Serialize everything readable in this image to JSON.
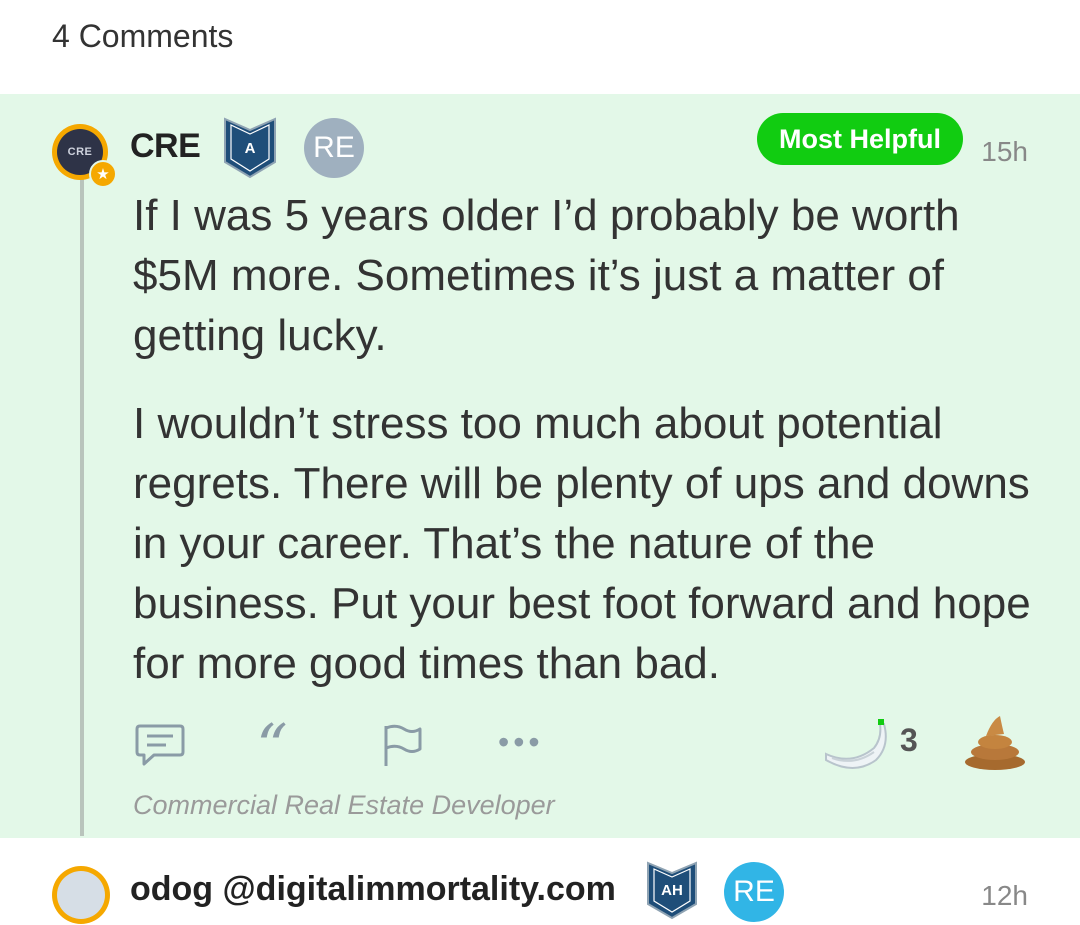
{
  "header": {
    "comment_count_label": "4 Comments"
  },
  "comment": {
    "avatar_text": "CRE",
    "username": "CRE",
    "level_badge": "A",
    "industry_badge": "RE",
    "most_helpful_label": "Most Helpful",
    "time": "15h",
    "paragraphs": [
      "If I was 5 years older I’d probably be worth $5M more. Sometimes it’s just a matter of getting lucky.",
      "I wouldn’t stress too much about potential regrets. There will be plenty of ups and downs in your career. That’s the nature of the business. Put your best foot forward and hope for more good times than bad."
    ],
    "actions": {
      "reply_icon": "reply-icon",
      "quote_icon": "quote-icon",
      "flag_icon": "flag-icon",
      "more_icon": "more-icon",
      "banana_icon": "banana-icon",
      "banana_count": "3",
      "poop_icon": "poop-icon"
    },
    "user_title": "Commercial Real Estate Developer"
  },
  "next_comment": {
    "username": "odog @digitalimmortality.com",
    "level_badge": "AH",
    "industry_badge": "RE",
    "time": "12h"
  },
  "colors": {
    "comment_bg": "#e3f8e8",
    "most_helpful": "#11cc11",
    "avatar_ring": "#f5a800",
    "badge_navy": "#1f4e79",
    "re_grey": "#9fb0bf",
    "re_blue": "#31b5e6"
  }
}
